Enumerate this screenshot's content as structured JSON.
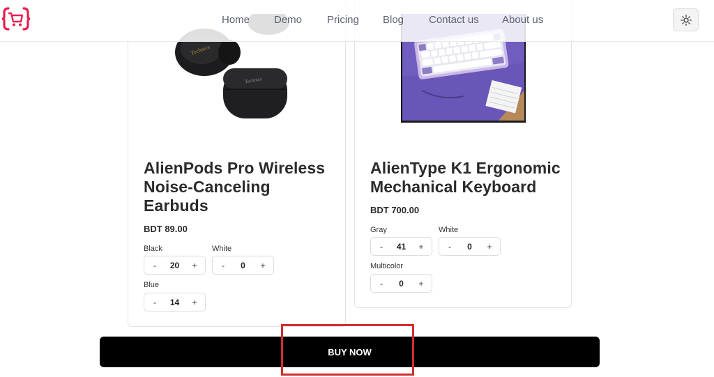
{
  "header": {
    "nav": [
      {
        "label": "Home"
      },
      {
        "label": "Demo"
      },
      {
        "label": "Pricing"
      },
      {
        "label": "Blog"
      },
      {
        "label": "Contact us"
      },
      {
        "label": "About us"
      }
    ],
    "logo_icon": "cart-braces-logo",
    "theme_icon": "sun-icon",
    "accent_color": "#e8204f"
  },
  "products": [
    {
      "title_line1": "AlienPods Pro Wireless",
      "title_line2": "Noise-Canceling",
      "title_line3": "Earbuds",
      "price": "BDT 89.00",
      "variants": [
        {
          "label": "Black",
          "qty": "20"
        },
        {
          "label": "White",
          "qty": "0"
        },
        {
          "label": "Blue",
          "qty": "14"
        }
      ]
    },
    {
      "title_line1": "AlienType K1 Ergonomic",
      "title_line2": "Mechanical Keyboard",
      "price": "BDT 700.00",
      "variants": [
        {
          "label": "Gray",
          "qty": "41"
        },
        {
          "label": "White",
          "qty": "0"
        },
        {
          "label": "Multicolor",
          "qty": "0"
        }
      ]
    }
  ],
  "stepper": {
    "minus": "-",
    "plus": "+"
  },
  "buy_now_label": "BUY NOW",
  "highlight_color": "#d42d2d"
}
